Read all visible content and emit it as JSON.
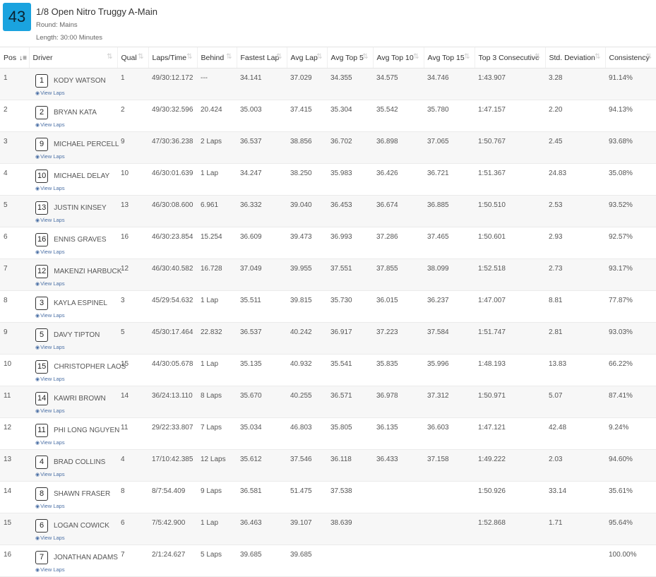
{
  "race": {
    "number": "43",
    "title": "1/8 Open Nitro Truggy A-Main",
    "round": "Round: Mains",
    "length": "Length: 30:00 Minutes"
  },
  "columns": [
    "Pos",
    "Driver",
    "Qual",
    "Laps/Time",
    "Behind",
    "Fastest Lap",
    "Avg Lap",
    "Avg Top 5",
    "Avg Top 10",
    "Avg Top 15",
    "Top 3 Consecutive",
    "Std. Deviation",
    "Consistency"
  ],
  "view_laps_label": "View Laps",
  "rows": [
    {
      "pos": "1",
      "car": "1",
      "driver": "KODY WATSON",
      "qual": "1",
      "laps": "49/30:12.172",
      "behind": "---",
      "fastest": "34.141",
      "avg": "37.029",
      "top5": "34.355",
      "top10": "34.575",
      "top15": "34.746",
      "top3c": "1:43.907",
      "std": "3.28",
      "cons": "91.14%"
    },
    {
      "pos": "2",
      "car": "2",
      "driver": "BRYAN KATA",
      "qual": "2",
      "laps": "49/30:32.596",
      "behind": "20.424",
      "fastest": "35.003",
      "avg": "37.415",
      "top5": "35.304",
      "top10": "35.542",
      "top15": "35.780",
      "top3c": "1:47.157",
      "std": "2.20",
      "cons": "94.13%"
    },
    {
      "pos": "3",
      "car": "9",
      "driver": "MICHAEL PERCELL",
      "qual": "9",
      "laps": "47/30:36.238",
      "behind": "2 Laps",
      "fastest": "36.537",
      "avg": "38.856",
      "top5": "36.702",
      "top10": "36.898",
      "top15": "37.065",
      "top3c": "1:50.767",
      "std": "2.45",
      "cons": "93.68%"
    },
    {
      "pos": "4",
      "car": "10",
      "driver": "MICHAEL DELAY",
      "qual": "10",
      "laps": "46/30:01.639",
      "behind": "1 Lap",
      "fastest": "34.247",
      "avg": "38.250",
      "top5": "35.983",
      "top10": "36.426",
      "top15": "36.721",
      "top3c": "1:51.367",
      "std": "24.83",
      "cons": "35.08%"
    },
    {
      "pos": "5",
      "car": "13",
      "driver": "JUSTIN KINSEY",
      "qual": "13",
      "laps": "46/30:08.600",
      "behind": "6.961",
      "fastest": "36.332",
      "avg": "39.040",
      "top5": "36.453",
      "top10": "36.674",
      "top15": "36.885",
      "top3c": "1:50.510",
      "std": "2.53",
      "cons": "93.52%"
    },
    {
      "pos": "6",
      "car": "16",
      "driver": "ENNIS GRAVES",
      "qual": "16",
      "laps": "46/30:23.854",
      "behind": "15.254",
      "fastest": "36.609",
      "avg": "39.473",
      "top5": "36.993",
      "top10": "37.286",
      "top15": "37.465",
      "top3c": "1:50.601",
      "std": "2.93",
      "cons": "92.57%"
    },
    {
      "pos": "7",
      "car": "12",
      "driver": "MAKENZI HARBUCK",
      "qual": "12",
      "laps": "46/30:40.582",
      "behind": "16.728",
      "fastest": "37.049",
      "avg": "39.955",
      "top5": "37.551",
      "top10": "37.855",
      "top15": "38.099",
      "top3c": "1:52.518",
      "std": "2.73",
      "cons": "93.17%"
    },
    {
      "pos": "8",
      "car": "3",
      "driver": "KAYLA ESPINEL",
      "qual": "3",
      "laps": "45/29:54.632",
      "behind": "1 Lap",
      "fastest": "35.511",
      "avg": "39.815",
      "top5": "35.730",
      "top10": "36.015",
      "top15": "36.237",
      "top3c": "1:47.007",
      "std": "8.81",
      "cons": "77.87%"
    },
    {
      "pos": "9",
      "car": "5",
      "driver": "DAVY TIPTON",
      "qual": "5",
      "laps": "45/30:17.464",
      "behind": "22.832",
      "fastest": "36.537",
      "avg": "40.242",
      "top5": "36.917",
      "top10": "37.223",
      "top15": "37.584",
      "top3c": "1:51.747",
      "std": "2.81",
      "cons": "93.03%"
    },
    {
      "pos": "10",
      "car": "15",
      "driver": "CHRISTOPHER LAOS",
      "qual": "15",
      "laps": "44/30:05.678",
      "behind": "1 Lap",
      "fastest": "35.135",
      "avg": "40.932",
      "top5": "35.541",
      "top10": "35.835",
      "top15": "35.996",
      "top3c": "1:48.193",
      "std": "13.83",
      "cons": "66.22%"
    },
    {
      "pos": "11",
      "car": "14",
      "driver": "KAWRI BROWN",
      "qual": "14",
      "laps": "36/24:13.110",
      "behind": "8 Laps",
      "fastest": "35.670",
      "avg": "40.255",
      "top5": "36.571",
      "top10": "36.978",
      "top15": "37.312",
      "top3c": "1:50.971",
      "std": "5.07",
      "cons": "87.41%"
    },
    {
      "pos": "12",
      "car": "11",
      "driver": "PHI LONG NGUYEN",
      "qual": "11",
      "laps": "29/22:33.807",
      "behind": "7 Laps",
      "fastest": "35.034",
      "avg": "46.803",
      "top5": "35.805",
      "top10": "36.135",
      "top15": "36.603",
      "top3c": "1:47.121",
      "std": "42.48",
      "cons": "9.24%"
    },
    {
      "pos": "13",
      "car": "4",
      "driver": "BRAD COLLINS",
      "qual": "4",
      "laps": "17/10:42.385",
      "behind": "12 Laps",
      "fastest": "35.612",
      "avg": "37.546",
      "top5": "36.118",
      "top10": "36.433",
      "top15": "37.158",
      "top3c": "1:49.222",
      "std": "2.03",
      "cons": "94.60%"
    },
    {
      "pos": "14",
      "car": "8",
      "driver": "SHAWN FRASER",
      "qual": "8",
      "laps": "8/7:54.409",
      "behind": "9 Laps",
      "fastest": "36.581",
      "avg": "51.475",
      "top5": "37.538",
      "top10": "",
      "top15": "",
      "top3c": "1:50.926",
      "std": "33.14",
      "cons": "35.61%"
    },
    {
      "pos": "15",
      "car": "6",
      "driver": "LOGAN COWICK",
      "qual": "6",
      "laps": "7/5:42.900",
      "behind": "1 Lap",
      "fastest": "36.463",
      "avg": "39.107",
      "top5": "38.639",
      "top10": "",
      "top15": "",
      "top3c": "1:52.868",
      "std": "1.71",
      "cons": "95.64%"
    },
    {
      "pos": "16",
      "car": "7",
      "driver": "JONATHAN ADAMS",
      "qual": "7",
      "laps": "2/1:24.627",
      "behind": "5 Laps",
      "fastest": "39.685",
      "avg": "39.685",
      "top5": "",
      "top10": "",
      "top15": "",
      "top3c": "",
      "std": "",
      "cons": "100.00%"
    }
  ]
}
